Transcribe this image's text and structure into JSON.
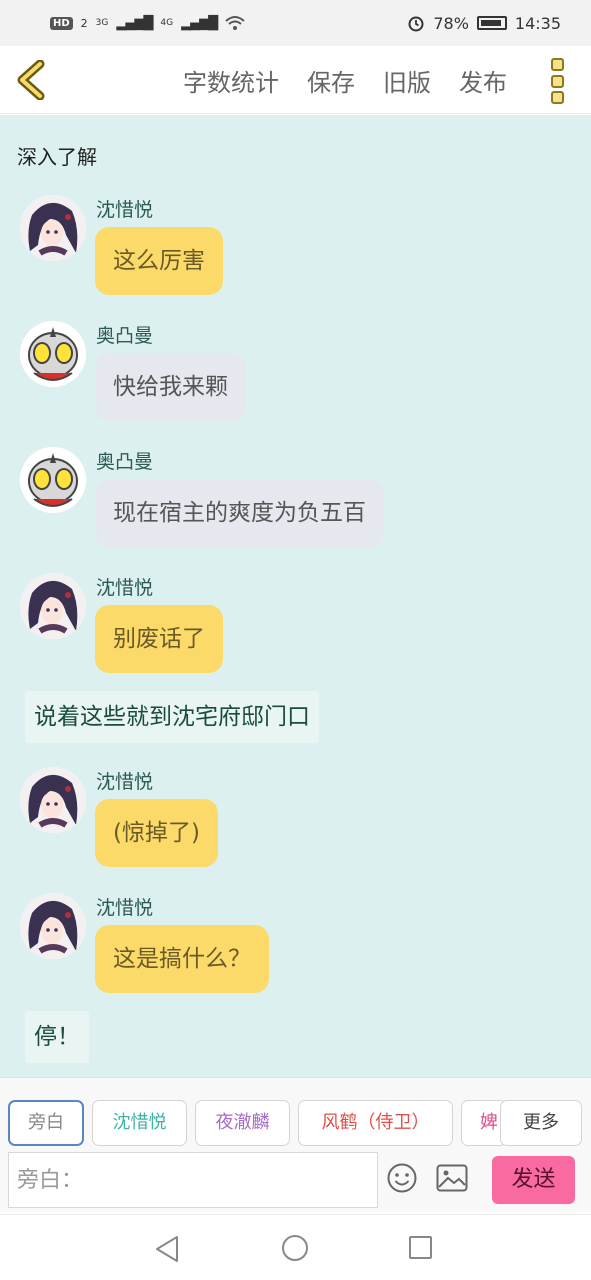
{
  "status_bar": {
    "network_badge": "HD",
    "network_sub": "2",
    "signal1": "3G",
    "signal2": "4G",
    "battery": "78%",
    "time": "14:35"
  },
  "toolbar": {
    "word_count": "字数统计",
    "save": "保存",
    "old_version": "旧版",
    "publish": "发布"
  },
  "chat": {
    "top_text": "深入了解",
    "messages": [
      {
        "speaker": "沈惜悦",
        "text": "这么厉害",
        "avatar": "anime-girl-avatar"
      },
      {
        "speaker": "奥凸曼",
        "text": "快给我来颗",
        "avatar": "ultraman-avatar"
      },
      {
        "speaker": "奥凸曼",
        "text": "现在宿主的爽度为负五百",
        "avatar": "ultraman-avatar"
      },
      {
        "speaker": "沈惜悦",
        "text": "别废话了",
        "avatar": "anime-girl-avatar"
      },
      {
        "narration": "说着这些就到沈宅府邸门口"
      },
      {
        "speaker": "沈惜悦",
        "text": "(惊掉了)",
        "avatar": "anime-girl-avatar"
      },
      {
        "speaker": "沈惜悦",
        "text": "这是搞什么？",
        "avatar": "anime-girl-avatar"
      },
      {
        "narration": "停！"
      }
    ]
  },
  "characters": [
    {
      "name": "旁白",
      "color": "#888888"
    },
    {
      "name": "沈惜悦",
      "color": "#3fb3a8"
    },
    {
      "name": "夜澈麟",
      "color": "#a66ac8"
    },
    {
      "name": "风鹤（侍卫）",
      "color": "#e0504a"
    },
    {
      "name": "婢",
      "color": "#e0508a"
    }
  ],
  "more_label": "更多",
  "input": {
    "placeholder": "旁白："
  },
  "send_label": "发送"
}
